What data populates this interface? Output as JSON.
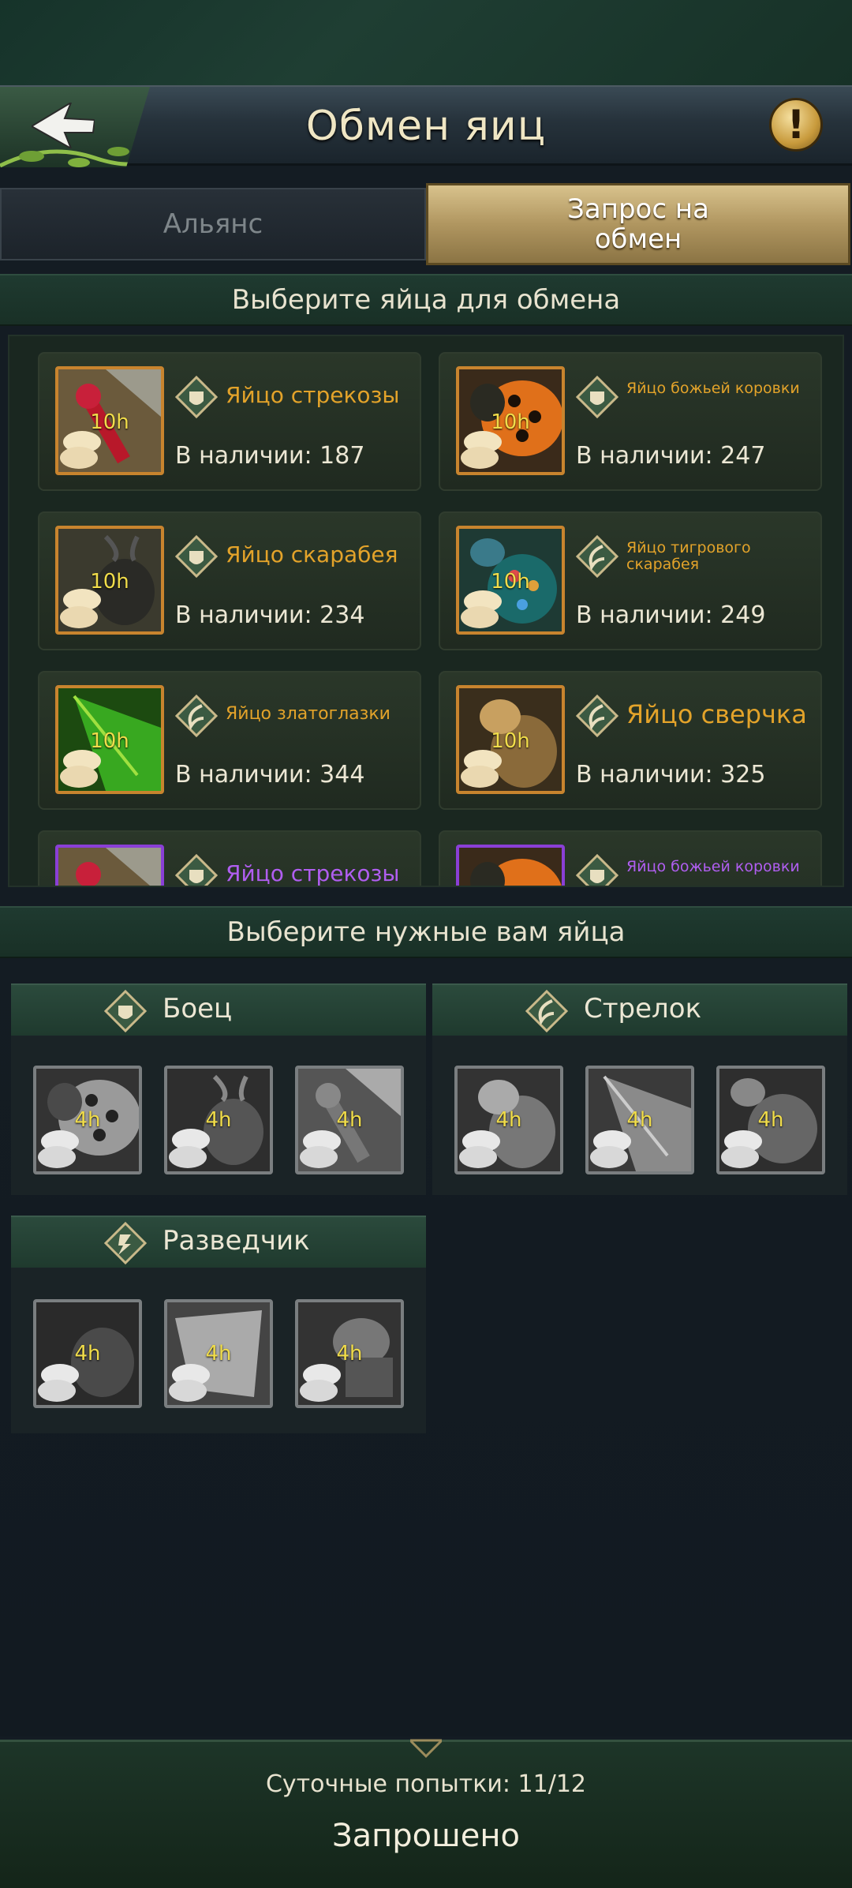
{
  "header": {
    "title": "Обмен яиц",
    "info_glyph": "!"
  },
  "tabs": {
    "alliance": "Альянс",
    "request": "Запрос на обмен"
  },
  "sections": {
    "select_offer": "Выберите яйца для обмена",
    "select_wanted": "Выберите нужные вам яйца"
  },
  "offer_eggs": [
    {
      "name": "Яйцо стрекозы",
      "count": "В наличии: 187",
      "time": "10h",
      "class": "fighter"
    },
    {
      "name": "Яйцо божьей коровки",
      "count": "В наличии: 247",
      "time": "10h",
      "class": "fighter"
    },
    {
      "name": "Яйцо скарабея",
      "count": "В наличии: 234",
      "time": "10h",
      "class": "fighter"
    },
    {
      "name": "Яйцо тигрового скарабея",
      "count": "В наличии: 249",
      "time": "10h",
      "class": "shooter"
    },
    {
      "name": "Яйцо златоглазки",
      "count": "В наличии: 344",
      "time": "10h",
      "class": "shooter"
    },
    {
      "name": "Яйцо сверчка",
      "count": "В наличии: 325",
      "time": "10h",
      "class": "shooter"
    },
    {
      "name": "Яйцо стрекозы",
      "count": "",
      "time": "",
      "class": "fighter"
    },
    {
      "name": "Яйцо божьей коровки",
      "count": "",
      "time": "",
      "class": "fighter"
    }
  ],
  "wanted": {
    "fighter": {
      "label": "Боец",
      "slots": [
        "4h",
        "4h",
        "4h"
      ]
    },
    "shooter": {
      "label": "Стрелок",
      "slots": [
        "4h",
        "4h",
        "4h"
      ]
    },
    "scout": {
      "label": "Разведчик",
      "slots": [
        "4h",
        "4h",
        "4h"
      ]
    }
  },
  "footer": {
    "attempts": "Суточные попытки: 11/12",
    "status": "Запрошено"
  },
  "colors": {
    "accent_gold": "#e3a32a",
    "rare_purple": "#b05ef0",
    "tab_active": "#b09660",
    "timer_yellow": "#f0dc4a"
  },
  "icons": {
    "back": "back-arrow-icon",
    "info": "exclamation-icon",
    "fighter": "fighter-class-icon",
    "shooter": "shooter-class-icon",
    "scout": "scout-class-icon"
  }
}
